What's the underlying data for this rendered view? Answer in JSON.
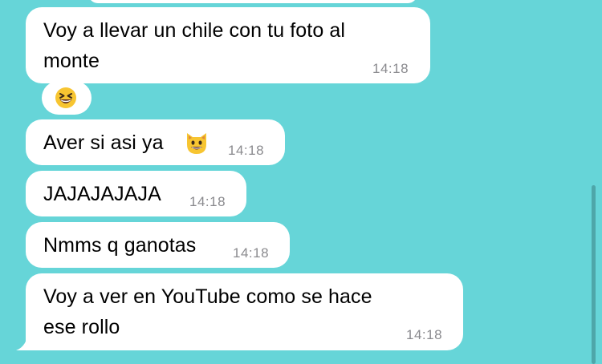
{
  "messages": [
    {
      "text": "Voy a llevar un chile con tu foto al\nmonte",
      "time": "14:18"
    },
    {
      "reaction": "grinning-squinting-face-emoji"
    },
    {
      "text": "Aver si asi ya",
      "emoji": "grinning-cat-emoji",
      "time": "14:18"
    },
    {
      "text": "JAJAJAJAJA",
      "time": "14:18"
    },
    {
      "text": "Nmms q ganotas",
      "time": "14:18"
    },
    {
      "text": "Voy a ver en YouTube como se hace\nese rollo",
      "time": "14:18"
    }
  ],
  "colors": {
    "background": "#66d5d8",
    "bubble": "#ffffff",
    "timestamp": "#8a8a8e"
  }
}
